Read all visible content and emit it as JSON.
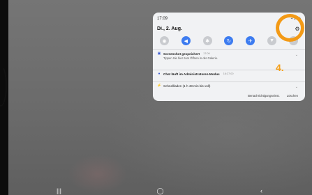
{
  "status": {
    "time": "17:09",
    "battery": "+ 28%"
  },
  "date": "Di., 2. Aug.",
  "quick_toggles": [
    {
      "icon": "wifi-icon",
      "glyph": "◉",
      "on": false
    },
    {
      "icon": "sound-icon",
      "glyph": "◀",
      "on": true
    },
    {
      "icon": "bluetooth-icon",
      "glyph": "✱",
      "on": false
    },
    {
      "icon": "autorotate-icon",
      "glyph": "↻",
      "on": true
    },
    {
      "icon": "airplane-icon",
      "glyph": "✈",
      "on": true
    },
    {
      "icon": "flashlight-icon",
      "glyph": "▼",
      "on": false
    },
    {
      "icon": "more-icon",
      "glyph": "●",
      "on": false
    }
  ],
  "notifications": [
    {
      "title": "Screenshot gespeichert",
      "time": "17:09",
      "body": "Tippen Sie hier zum Öffnen in der Galerie."
    },
    {
      "title": "Chat läuft im Administratoren-Modus",
      "time": "16:27:00",
      "body": ""
    },
    {
      "title": "Schnellladen (1 h 48 min bis voll)",
      "time": "",
      "body": ""
    }
  ],
  "footer": {
    "settings": "Benachrichtigungseinst.",
    "clear": "Löschen"
  },
  "annotation": {
    "step_label": "4.",
    "accent": "#f39a16"
  },
  "nav": {
    "recent": "|||",
    "home": "◯",
    "back": "‹"
  }
}
